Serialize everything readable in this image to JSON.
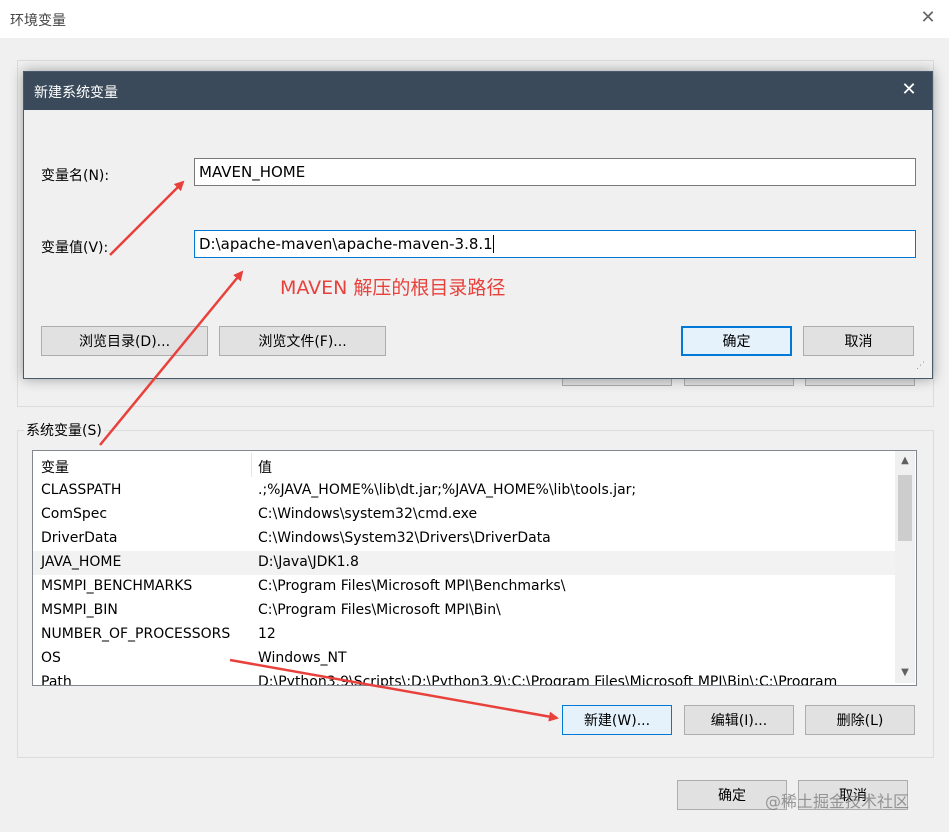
{
  "outer_window": {
    "title": "环境变量",
    "close_glyph": "✕",
    "system_vars_label": "系统变量(S)",
    "table_headers": {
      "name": "变量",
      "value": "值"
    },
    "rows": [
      {
        "name": "CLASSPATH",
        "value": ".;%JAVA_HOME%\\lib\\dt.jar;%JAVA_HOME%\\lib\\tools.jar;"
      },
      {
        "name": "ComSpec",
        "value": "C:\\Windows\\system32\\cmd.exe"
      },
      {
        "name": "DriverData",
        "value": "C:\\Windows\\System32\\Drivers\\DriverData"
      },
      {
        "name": "JAVA_HOME",
        "value": "D:\\Java\\JDK1.8"
      },
      {
        "name": "MSMPI_BENCHMARKS",
        "value": "C:\\Program Files\\Microsoft MPI\\Benchmarks\\"
      },
      {
        "name": "MSMPI_BIN",
        "value": "C:\\Program Files\\Microsoft MPI\\Bin\\"
      },
      {
        "name": "NUMBER_OF_PROCESSORS",
        "value": "12"
      },
      {
        "name": "OS",
        "value": "Windows_NT"
      },
      {
        "name": "Path",
        "value": "D:\\Python3.9\\Scripts\\;D:\\Python3.9\\;C:\\Program Files\\Microsoft MPI\\Bin\\;C:\\Program"
      }
    ],
    "buttons": {
      "new": "新建(W)...",
      "edit": "编辑(I)...",
      "delete": "删除(L)",
      "ok": "确定",
      "cancel": "取消"
    }
  },
  "dialog": {
    "title": "新建系统变量",
    "close_glyph": "✕",
    "name_label": "变量名(N):",
    "name_value": "MAVEN_HOME",
    "value_label": "变量值(V):",
    "value_value": "D:\\apache-maven\\apache-maven-3.8.1",
    "buttons": {
      "browse_dir": "浏览目录(D)...",
      "browse_file": "浏览文件(F)...",
      "ok": "确定",
      "cancel": "取消"
    }
  },
  "annotation": {
    "text": "MAVEN 解压的根目录路径",
    "color": "#e8413c"
  },
  "watermark": "@稀土掘金技术社区",
  "icons": {
    "scroll_up": "▲",
    "scroll_down": "▼",
    "resize_grip": "⋰"
  }
}
